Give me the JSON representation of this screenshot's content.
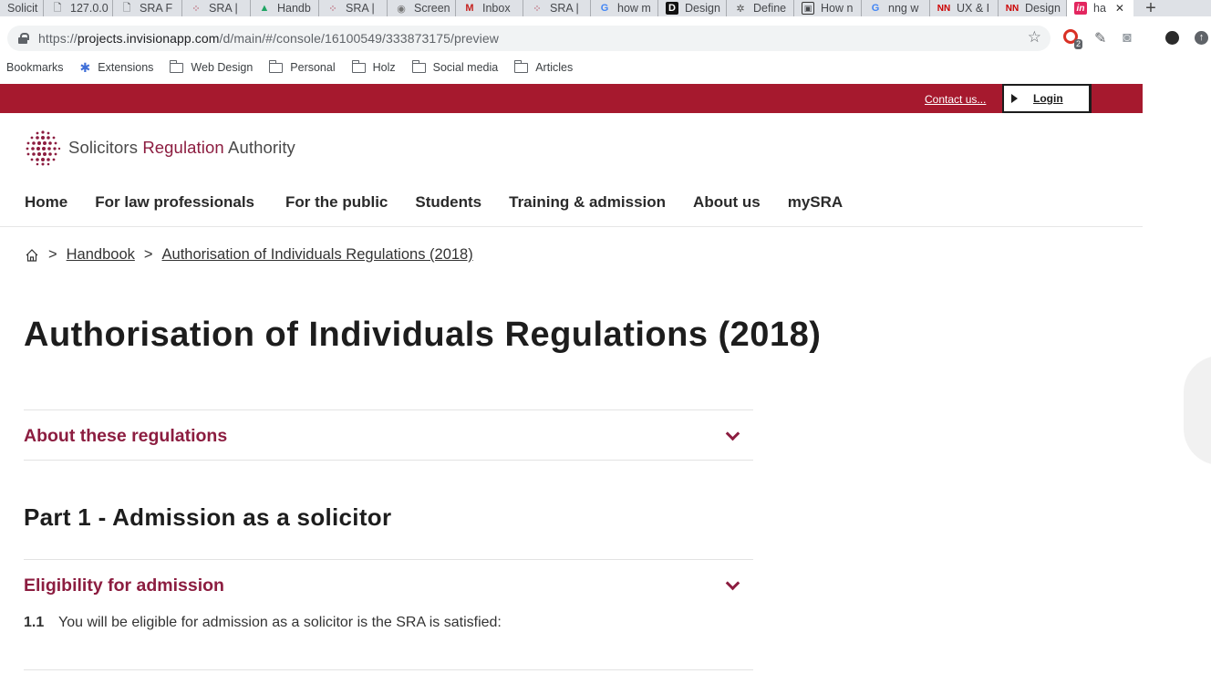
{
  "browser": {
    "tabs": [
      {
        "label": "Solicit",
        "icon": "sra-favicon"
      },
      {
        "label": "127.0.0",
        "icon": "document-icon"
      },
      {
        "label": "SRA F",
        "icon": "document-icon"
      },
      {
        "label": "SRA |",
        "icon": "sra-favicon"
      },
      {
        "label": "Handb",
        "icon": "drive-icon"
      },
      {
        "label": "SRA |",
        "icon": "sra-favicon"
      },
      {
        "label": "Screen",
        "icon": "camera-icon"
      },
      {
        "label": "Inbox",
        "icon": "gmail-icon"
      },
      {
        "label": "SRA |",
        "icon": "sra-favicon"
      },
      {
        "label": "how m",
        "icon": "google-icon"
      },
      {
        "label": "Design",
        "icon": "d-icon"
      },
      {
        "label": "Define",
        "icon": "tree-icon"
      },
      {
        "label": "How n",
        "icon": "photo-icon"
      },
      {
        "label": "nng w",
        "icon": "google-icon"
      },
      {
        "label": "UX & I",
        "icon": "nn-icon"
      },
      {
        "label": "Design",
        "icon": "nn-icon"
      },
      {
        "label": "ha",
        "icon": "invision-icon",
        "active": true
      }
    ],
    "new_tab": "+",
    "url_prefix": "https://",
    "url_host": "projects.invisionapp.com",
    "url_path": "/d/main/#/console/16100549/333873175/preview",
    "extension_badge": "2",
    "bookmarks": [
      "Bookmarks",
      "Extensions",
      "Web Design",
      "Personal",
      "Holz",
      "Social media",
      "Articles"
    ]
  },
  "site": {
    "contact_label": "Contact us...",
    "login_label": "Login",
    "logo": {
      "word1": "Solicitors",
      "word2": "Regulation",
      "word3": "Authority"
    },
    "nav": [
      "Home",
      "For law professionals",
      "For the public",
      "Students",
      "Training & admission",
      "About us",
      "mySRA"
    ],
    "breadcrumb": {
      "sep": ">",
      "items": [
        "Handbook",
        "Authorisation of Individuals Regulations (2018)"
      ]
    },
    "page_title": "Authorisation of Individuals Regulations (2018)",
    "accordion_about": "About these regulations",
    "part_heading": "Part 1 - Admission as a solicitor",
    "accordion_eligibility": "Eligibility for admission",
    "clause": {
      "number": "1.1",
      "text": "You will be eligible for admission as a solicitor is the SRA is satisfied:"
    }
  },
  "colors": {
    "brand": "#a6192e",
    "accent": "#8c1d40"
  }
}
